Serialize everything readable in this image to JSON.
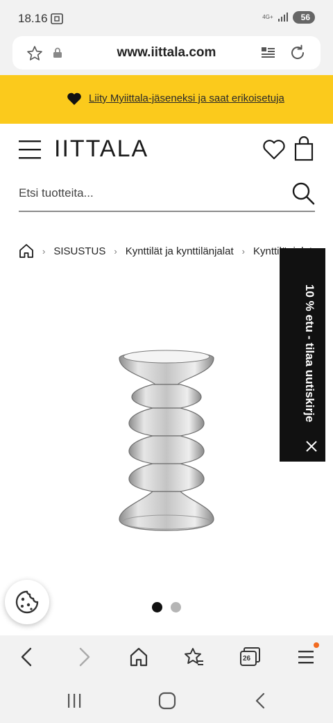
{
  "status_bar": {
    "time": "18.16",
    "network": "4G+",
    "battery": "56"
  },
  "browser": {
    "url": "www.iittala.com",
    "tab_count": "26"
  },
  "promo": {
    "text": "Liity Myiittala-jäseneksi ja saat erikoisetuja"
  },
  "header": {
    "logo": "IITTALA"
  },
  "search": {
    "placeholder": "Etsi tuotteita..."
  },
  "breadcrumb": {
    "items": [
      "SISUSTUS",
      "Kynttilät ja kynttilänjalat",
      "Kynttilänjalat"
    ]
  },
  "newsletter_tab": {
    "text": "10 % etu - tilaa uutiskirje"
  },
  "carousel": {
    "total": 2,
    "active": 0
  },
  "colors": {
    "promo": "#fbca1c",
    "accent_dot": "#f26b21",
    "dark": "#111111"
  }
}
